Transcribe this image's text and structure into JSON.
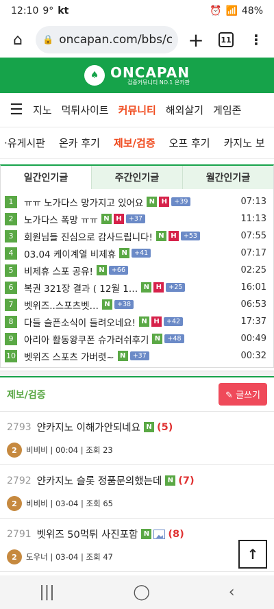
{
  "status": {
    "time": "12:10",
    "temp": "9°",
    "carrier": "kt",
    "battery": "48%"
  },
  "browser": {
    "url": "oncapan.com/bbs/c",
    "tab_count": "11"
  },
  "site": {
    "logo": "ONCAPAN",
    "tagline": "검증커뮤니티 NO.1 온카판"
  },
  "main_nav": [
    "지노",
    "먹튀사이트",
    "커뮤니티",
    "해외살기",
    "게임존"
  ],
  "sub_nav": [
    "·유게시판",
    "온카 후기",
    "제보/검증",
    "오프 후기",
    "카지노 보"
  ],
  "popular_tabs": [
    "일간인기글",
    "주간인기글",
    "월간인기글"
  ],
  "ranking": [
    {
      "num": "1",
      "title": "ㅠㅠ 노가다스 망가지고 있어요",
      "n": "N",
      "h": "H",
      "count": "+39",
      "time": "07:13"
    },
    {
      "num": "2",
      "title": "노가다스 폭망 ㅠㅠ",
      "n": "N",
      "h": "H",
      "count": "+37",
      "time": "11:13"
    },
    {
      "num": "3",
      "title": "회원님들 진심으로 감사드립니다!",
      "n": "N",
      "h": "H",
      "count": "+53",
      "time": "07:55"
    },
    {
      "num": "4",
      "title": "03.04 케이계열 비제휴",
      "n": "N",
      "h": "",
      "count": "+41",
      "time": "07:17"
    },
    {
      "num": "5",
      "title": "비제휴 스포 공유!",
      "n": "N",
      "h": "",
      "count": "+66",
      "time": "02:25"
    },
    {
      "num": "6",
      "title": "복권 321장 결과 ( 12월 1…",
      "n": "N",
      "h": "H",
      "count": "+25",
      "time": "16:01"
    },
    {
      "num": "7",
      "title": "벳위즈..스포츠벳…",
      "n": "N",
      "h": "",
      "count": "+38",
      "time": "06:53"
    },
    {
      "num": "8",
      "title": "다들 슬픈소식이 들려오네요!",
      "n": "N",
      "h": "H",
      "count": "+42",
      "time": "17:37"
    },
    {
      "num": "9",
      "title": "아리아 활동왕쿠폰 슈가러쉬후기",
      "n": "N",
      "h": "",
      "count": "+48",
      "time": "00:49"
    },
    {
      "num": "10",
      "title": "벳위즈 스포츠 가버렷~",
      "n": "N",
      "h": "",
      "count": "+37",
      "time": "00:32"
    }
  ],
  "board": {
    "title": "제보/검증",
    "write_label": "글쓰기"
  },
  "posts": [
    {
      "num": "2793",
      "title": "얀카지노 이해가안되네요",
      "n": "N",
      "count": "(5)",
      "author": "비비비",
      "date": "00:04",
      "views": "조회 23",
      "level": "2"
    },
    {
      "num": "2792",
      "title": "얀카지노 슬롯 정품문의했는데",
      "n": "N",
      "count": "(7)",
      "author": "비비비",
      "date": "03-04",
      "views": "조회 65",
      "level": "2"
    },
    {
      "num": "2791",
      "title": "벳위즈 50먹튀 사진포함",
      "n": "N",
      "count": "(8)",
      "author": "도우너",
      "date": "03-04",
      "views": "조회 47",
      "level": "2"
    }
  ]
}
